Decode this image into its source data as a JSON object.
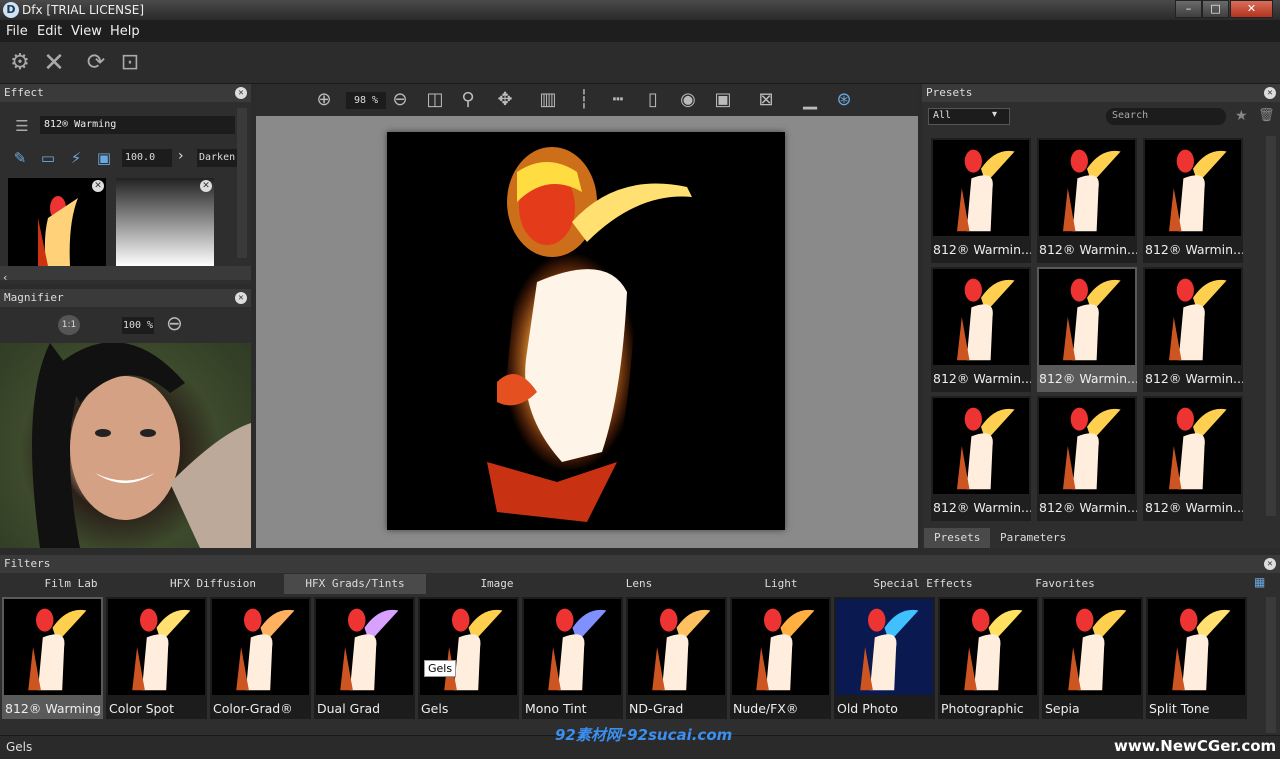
{
  "window": {
    "title": "Dfx [TRIAL LICENSE]",
    "app_icon": "D",
    "minimize": "–",
    "maximize": "□",
    "close": "✕"
  },
  "menu": [
    "File",
    "Edit",
    "View",
    "Help"
  ],
  "toolbar": {
    "icons": [
      "gear-icon",
      "close-icon",
      "refresh-icon",
      "fit-icon"
    ]
  },
  "effect": {
    "title": "Effect",
    "name": "812® Warming",
    "opacity": "100.0",
    "blend": "Darken",
    "layers": [
      "812® Warming",
      "Gradient mask"
    ]
  },
  "magnifier": {
    "title": "Magnifier",
    "ratio": "1:1",
    "zoom": "100 %"
  },
  "view": {
    "zoom": "98 %"
  },
  "presets": {
    "title": "Presets",
    "filter": "All",
    "search_placeholder": "Search",
    "items": [
      "812® Warmin...",
      "812® Warmin...",
      "812® Warmin...",
      "812® Warmin...",
      "812® Warmin...",
      "812® Warmin...",
      "812® Warmin...",
      "812® Warmin...",
      "812® Warmin..."
    ],
    "tabs": [
      "Presets",
      "Parameters"
    ]
  },
  "filters": {
    "title": "Filters",
    "tabs": [
      "Film Lab",
      "HFX Diffusion",
      "HFX Grads/Tints",
      "Image",
      "Lens",
      "Light",
      "Special Effects",
      "Favorites"
    ],
    "items": [
      "812® Warming",
      "Color Spot",
      "Color-Grad®",
      "Dual Grad",
      "Gels",
      "Mono Tint",
      "ND-Grad",
      "Nude/FX®",
      "Old Photo",
      "Photographic",
      "Sepia",
      "Split Tone"
    ],
    "tooltip": "Gels"
  },
  "status": {
    "text": "Gels"
  },
  "watermarks": {
    "left": "92素材网-92sucai.com",
    "right": "www.NewCGer.com"
  },
  "colors": {
    "accent": "#6aa9e0",
    "flame": "#ffb020",
    "selected_tab": "#4a4a4a"
  }
}
